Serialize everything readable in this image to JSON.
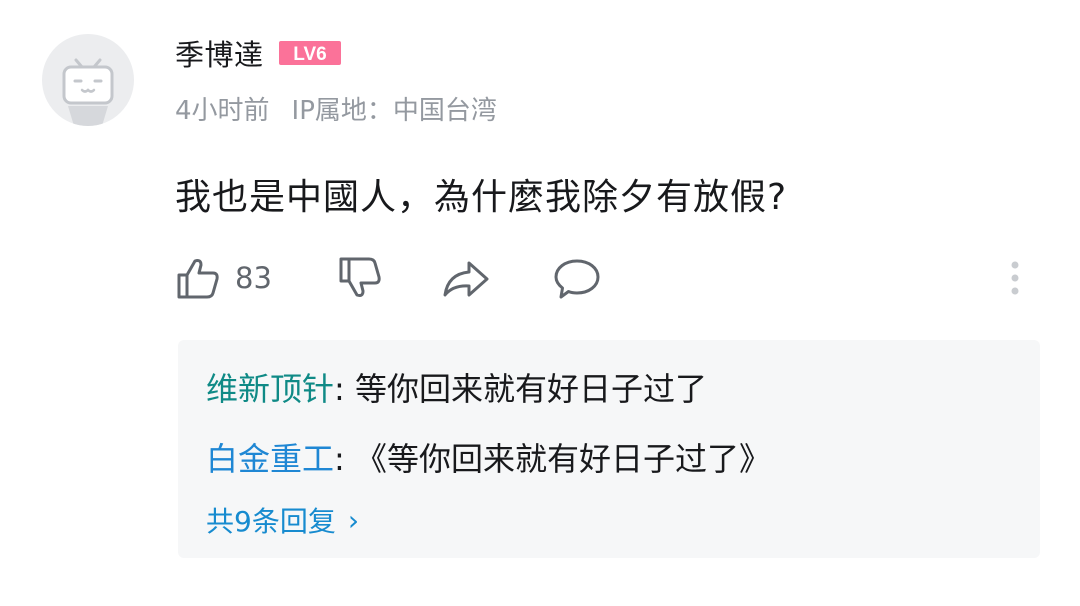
{
  "comment": {
    "username": "季博達",
    "level": "LV6",
    "time": "4小时前",
    "ip_location": "IP属地：中国台湾",
    "text": "我也是中國人，為什麼我除夕有放假?",
    "like_count": "83"
  },
  "replies": {
    "items": [
      {
        "name": "维新顶针",
        "separator": ":",
        "text": " 等你回来就有好日子过了"
      },
      {
        "name": "白金重工",
        "separator": ":",
        "text": " 《等你回来就有好日子过了》"
      }
    ],
    "more_label": "共9条回复",
    "more_chevron": "›"
  },
  "colors": {
    "level_badge": "#fb7299",
    "reply_name_teal": "#0f8a86",
    "reply_name_blue": "#1f87d4",
    "more_link": "#178bcf",
    "meta": "#9499a0"
  },
  "icons": [
    "avatar-tv-icon",
    "thumbs-up-icon",
    "thumbs-down-icon",
    "share-icon",
    "comment-icon",
    "more-vertical-icon"
  ]
}
